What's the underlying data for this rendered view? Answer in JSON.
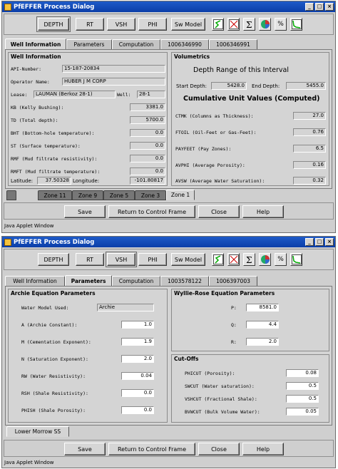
{
  "window1": {
    "title": "PfEFFER Process Dialog",
    "toolbar": {
      "buttons": [
        "DEPTH",
        "RT",
        "VSH",
        "PHI"
      ],
      "model_button": "Sw Model",
      "percent_icon_label": "%"
    },
    "tabs": [
      "Well Information",
      "Parameters",
      "Computation",
      "1006346990",
      "1006346991"
    ],
    "active_tab": "Well Information",
    "well_info": {
      "title": "Well Information",
      "api_label": "API-Number:",
      "api_value": "15-187-20834",
      "operator_label": "Operator Name:",
      "operator_value": "HUBER J M CORP",
      "lease_label": "Lease:",
      "lease_value": "LAUMAN (Berkoz 28-1)",
      "well_label": "Well:",
      "well_value": "28-1",
      "kb_label": "KB (Kelly Bushing):",
      "kb_value": "3381.0",
      "td_label": "TD (Total depth):",
      "td_value": "5700.0",
      "bht_label": "BHT (Bottom-hole temperature):",
      "bht_value": "0.0",
      "st_label": "ST (Surface temperature):",
      "st_value": "0.0",
      "rmf_label": "RMF (Mud filtrate resistivity):",
      "rmf_value": "0.0",
      "rmft_label": "RMFT (Mud filtrate temperature):",
      "rmft_value": "0.0",
      "lat_label": "Latitude:",
      "lat_value": "37.50328",
      "lon_label": "Longitude:",
      "lon_value": "-101.80817"
    },
    "volumetrics": {
      "title": "Volumetrics",
      "depth_title": "Depth Range of this Interval",
      "start_label": "Start Depth:",
      "start_value": "5428.0",
      "end_label": "End Depth:",
      "end_value": "5455.0",
      "cumulative_title": "Cumulative Unit Values (Computed)",
      "ctmk_label": "CTMK (Columns as Thickness):",
      "ctmk_value": "27.0",
      "ftoil_label": "FTOIL (Oil-Feet or Gas-Feet):",
      "ftoil_value": "0.76",
      "payfeet_label": "PAYFEET (Pay Zones):",
      "payfeet_value": "6.5",
      "avphi_label": "AVPHI (Average Porosity):",
      "avphi_value": "0.16",
      "avsw_label": "AVSW (Average Water Saturation):",
      "avsw_value": "0.32"
    },
    "zone_tabs": [
      "Zone 11",
      "Zone 9",
      "Zone 5",
      "Zone 3",
      "Zone 1"
    ],
    "active_zone": "Zone 1",
    "footer": [
      "Save",
      "Return to Control Frame",
      "Close",
      "Help"
    ],
    "status": "Java Applet Window"
  },
  "window2": {
    "title": "PfEFFER Process Dialog",
    "toolbar": {
      "buttons": [
        "DEPTH",
        "RT",
        "VSH",
        "PHI"
      ],
      "model_button": "Sw Model",
      "percent_icon_label": "%"
    },
    "tabs": [
      "Well Information",
      "Parameters",
      "Computation",
      "1003578122",
      "1006397003"
    ],
    "active_tab": "Parameters",
    "archie": {
      "title": "Archie Equation Parameters",
      "model_label": "Water Model Used:",
      "model_value": "Archie",
      "a_label": "A (Archie Constant):",
      "a_value": "1.0",
      "m_label": "M (Cementation Exponent):",
      "m_value": "1.9",
      "n_label": "N (Saturation Exponent):",
      "n_value": "2.0",
      "rw_label": "RW (Water Resistivity):",
      "rw_value": "0.04",
      "rsh_label": "RSH (Shale Resistivity):",
      "rsh_value": "0.0",
      "phish_label": "PHISH (Shale Porosity):",
      "phish_value": "0.0"
    },
    "wyllie": {
      "title": "Wyllie-Rose Equation Parameters",
      "p_label": "P:",
      "p_value": "8581.0",
      "q_label": "Q:",
      "q_value": "4.4",
      "r_label": "R:",
      "r_value": "2.0"
    },
    "cutoffs": {
      "title": "Cut-Offs",
      "phicut_label": "PHICUT (Porosity):",
      "phicut_value": "0.08",
      "swcut_label": "SWCUT (Water saturation):",
      "swcut_value": "0.5",
      "vshcut_label": "VSHCUT (Fractional Shale):",
      "vshcut_value": "0.5",
      "bvwcut_label": "BVWCUT (Bulk Volume Water):",
      "bvwcut_value": "0.05"
    },
    "zone_tab": "Lower Morrow SS",
    "footer": [
      "Save",
      "Return to Control Frame",
      "Close",
      "Help"
    ],
    "status": "Java Applet Window"
  }
}
